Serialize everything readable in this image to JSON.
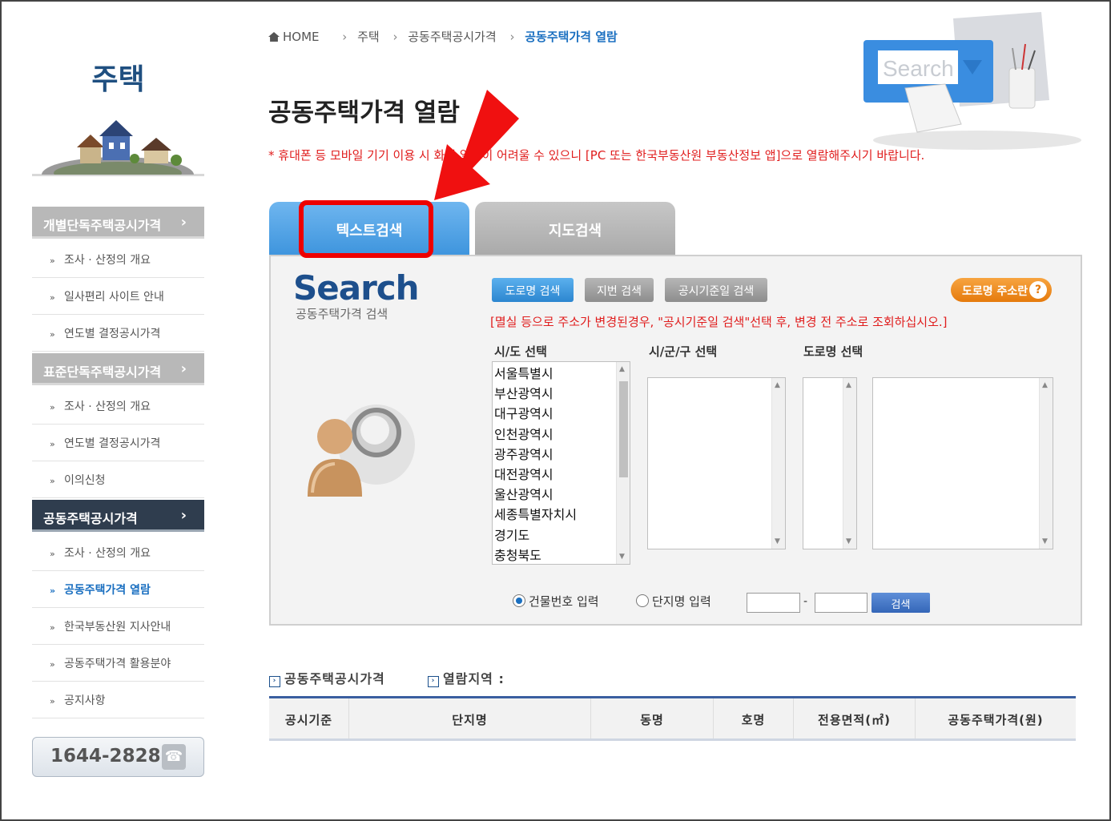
{
  "sidebar": {
    "title": "주택",
    "groups": [
      {
        "label": "개별단독주택공시가격",
        "chev": "›",
        "items": [
          "조사 · 산정의 개요",
          "일사편리 사이트 안내",
          "연도별 결정공시가격"
        ]
      },
      {
        "label": "표준단독주택공시가격",
        "chev": "›",
        "items": [
          "조사 · 산정의 개요",
          "연도별 결정공시가격",
          "이의신청"
        ]
      },
      {
        "label": "공동주택공시가격",
        "chev": "›",
        "items": [
          "조사 · 산정의 개요",
          "공동주택가격 열람",
          "한국부동산원 지사안내",
          "공동주택가격 활용분야",
          "공지사항"
        ]
      }
    ],
    "bullet": "»",
    "phone": "1644-2828"
  },
  "breadcrumb": {
    "home": "HOME",
    "items": [
      "주택",
      "공동주택공시가격",
      "공동주택가격 열람"
    ],
    "sep": "›"
  },
  "page": {
    "title": "공동주택가격 열람",
    "notice": "* 휴대폰 등 모바일 기기 이용 시 화면 열람이 어려울 수 있으니 [PC 또는 한국부동산원 부동산정보 앱]으로 열람해주시기 바랍니다."
  },
  "header_illus": {
    "search_word": "Search"
  },
  "tabs": {
    "text_search": "텍스트검색",
    "map_search": "지도검색"
  },
  "search": {
    "logo": "Search",
    "sub": "공동주택가격 검색",
    "btn_road": "도로명 검색",
    "btn_lot": "지번 검색",
    "btn_date": "공시기준일 검색",
    "btn_addr": "도로명 주소란",
    "btn_addr_q": "?",
    "warning": "[멸실 등으로 주소가 변경된경우, \"공시기준일 검색\"선택 후, 변경 전 주소로 조회하십시오.]",
    "label_sido": "시/도 선택",
    "label_sigungu": "시/군/구 선택",
    "label_road": "도로명 선택",
    "sido_options": [
      "서울특별시",
      "부산광역시",
      "대구광역시",
      "인천광역시",
      "광주광역시",
      "대전광역시",
      "울산광역시",
      "세종특별자치시",
      "경기도",
      "충청북도"
    ],
    "radio_building": "건물번호 입력",
    "radio_complex": "단지명 입력",
    "dash": "-",
    "btn_go": "검색"
  },
  "result": {
    "label1": "공동주택공시가격",
    "label2": "열람지역 :",
    "columns": [
      "공시기준",
      "단지명",
      "동명",
      "호명",
      "전용면적(㎡)",
      "공동주택가격(원)"
    ]
  }
}
